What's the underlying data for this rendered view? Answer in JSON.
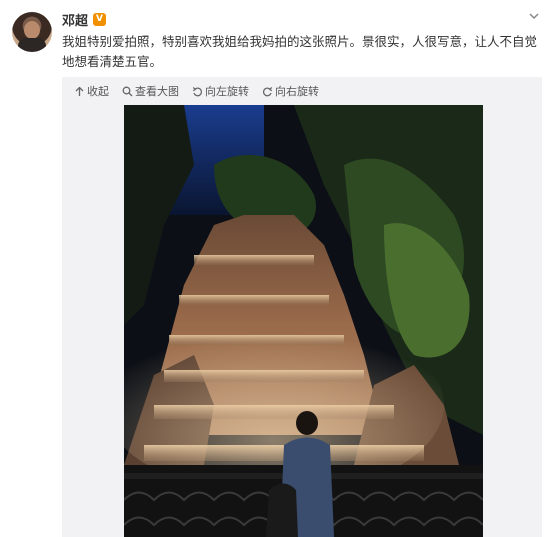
{
  "post": {
    "username": "邓超",
    "verified_badge": "V",
    "text": "我姐特别爱拍照，特别喜欢我姐给我妈拍的这张照片。景很实，人很写意，让人不自觉地想看清楚五官。"
  },
  "toolbar": {
    "collapse_label": "收起",
    "view_large_label": "查看大图",
    "rotate_left_label": "向左旋转",
    "rotate_right_label": "向右旋转"
  },
  "icons": {
    "collapse": "arrow-up-icon",
    "view_large": "magnifier-icon",
    "rotate_left": "rotate-left-icon",
    "rotate_right": "rotate-right-icon",
    "more": "chevron-down-icon"
  },
  "colors": {
    "verified": "#f29100",
    "media_background": "#f2f2f5",
    "text": "#333333"
  }
}
